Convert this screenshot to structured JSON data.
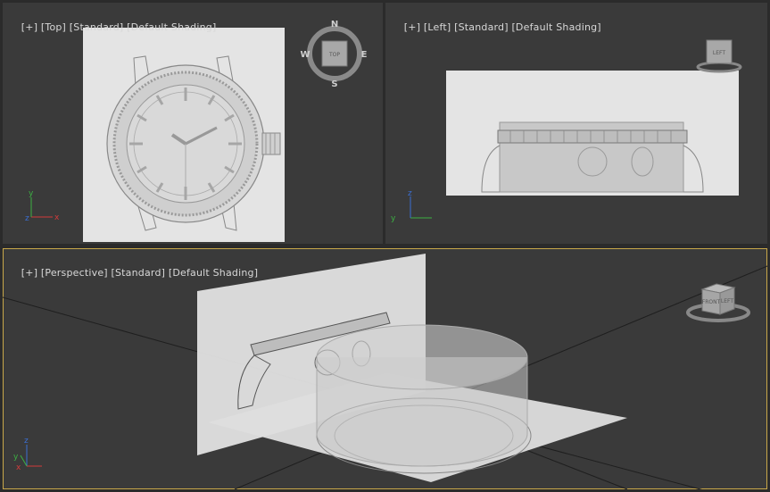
{
  "viewports": {
    "top": {
      "label": {
        "plus": "[+]",
        "view": "[Top]",
        "mode": "[Standard]",
        "shading": "[Default Shading]"
      },
      "viewcube_face": "TOP",
      "compass": {
        "n": "N",
        "s": "S",
        "e": "E",
        "w": "W"
      },
      "axes": {
        "x": "x",
        "y": "y",
        "z": "z"
      }
    },
    "left": {
      "label": {
        "plus": "[+]",
        "view": "[Left]",
        "mode": "[Standard]",
        "shading": "[Default Shading]"
      },
      "viewcube_face": "LEFT",
      "axes": {
        "y": "y",
        "z": "z"
      }
    },
    "perspective": {
      "label": {
        "plus": "[+]",
        "view": "[Perspective]",
        "mode": "[Standard]",
        "shading": "[Default Shading]"
      },
      "viewcube_faces": {
        "front": "FRONT",
        "left": "LEFT"
      },
      "axes": {
        "x": "x",
        "y": "y",
        "z": "z"
      }
    }
  },
  "colors": {
    "viewport_bg": "#3a3a3a",
    "active_border": "#c9a84a",
    "axis_x": "#d23b3b",
    "axis_y": "#3cb043",
    "axis_z": "#3b6fd2"
  }
}
